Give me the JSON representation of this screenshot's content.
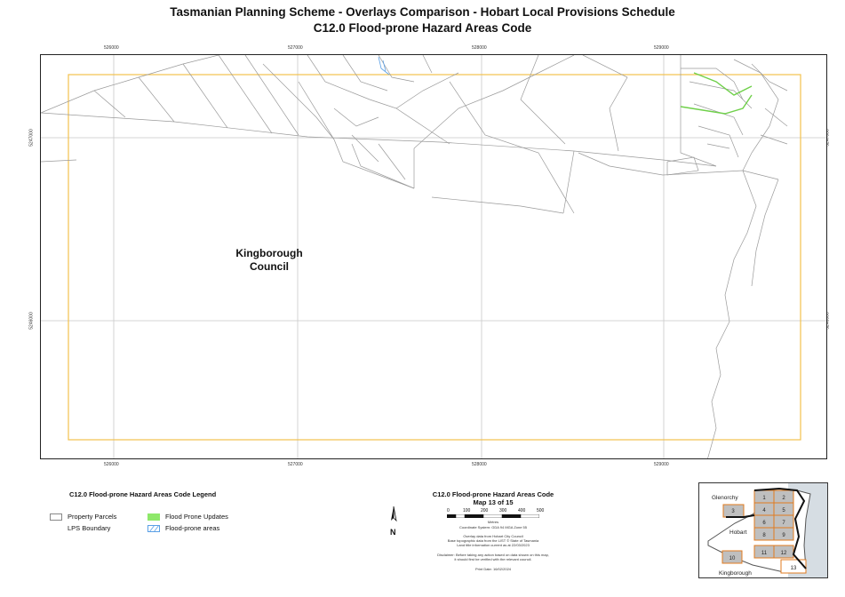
{
  "header": {
    "title": "Tasmanian Planning Scheme - Overlays Comparison - Hobart Local Provisions Schedule",
    "subtitle": "C12.0 Flood-prone Hazard Areas Code"
  },
  "grid": {
    "x_ticks": [
      "526000",
      "527000",
      "528000",
      "529000"
    ],
    "y_ticks": [
      "5247000",
      "5246000"
    ]
  },
  "map": {
    "council_label_line1": "Kingborough",
    "council_label_line2": "Council",
    "colors": {
      "lps_boundary": "#f2c14e",
      "flood_updates": "#8ee86a",
      "parcel_line": "#9a9a9a",
      "hatch": "#5aa0e6"
    }
  },
  "legend": {
    "title": "C12.0 Flood-prone Hazard Areas Code Legend",
    "items": [
      {
        "label": "Property Parcels"
      },
      {
        "label": "LPS Boundary"
      },
      {
        "label": "Flood Prone Updates"
      },
      {
        "label": "Flood-prone areas"
      }
    ]
  },
  "map_info": {
    "title": "C12.0 Flood-prone Hazard Areas Code",
    "map_number": "Map 13 of 15",
    "scale_labels": [
      "0",
      "100",
      "200",
      "300",
      "400",
      "500"
    ],
    "scale_unit": "Metres",
    "coordinate_system": "Coordinate System: GDA 94 MGA Zone 55",
    "source_lines": [
      "Overlay data from Hobart City Council",
      "Base topographic data from the LIST © State of Tasmania",
      "Land title information current as at 22/03/2023"
    ],
    "disclaimer_lines": [
      "Disclaimer: Before taking any action based on data shown on this map,",
      "it should first be verified with the relevant council."
    ],
    "print_date": "Print Date: 16/02/2024",
    "north_label": "N"
  },
  "keymap": {
    "labels": {
      "glenorchy": "Glenorchy",
      "hobart": "Hobart",
      "kingborough": "Kingborough"
    },
    "tiles": [
      "1",
      "2",
      "3",
      "4",
      "5",
      "6",
      "7",
      "8",
      "9",
      "10",
      "11",
      "12",
      "13"
    ],
    "highlight_tile": "13"
  }
}
